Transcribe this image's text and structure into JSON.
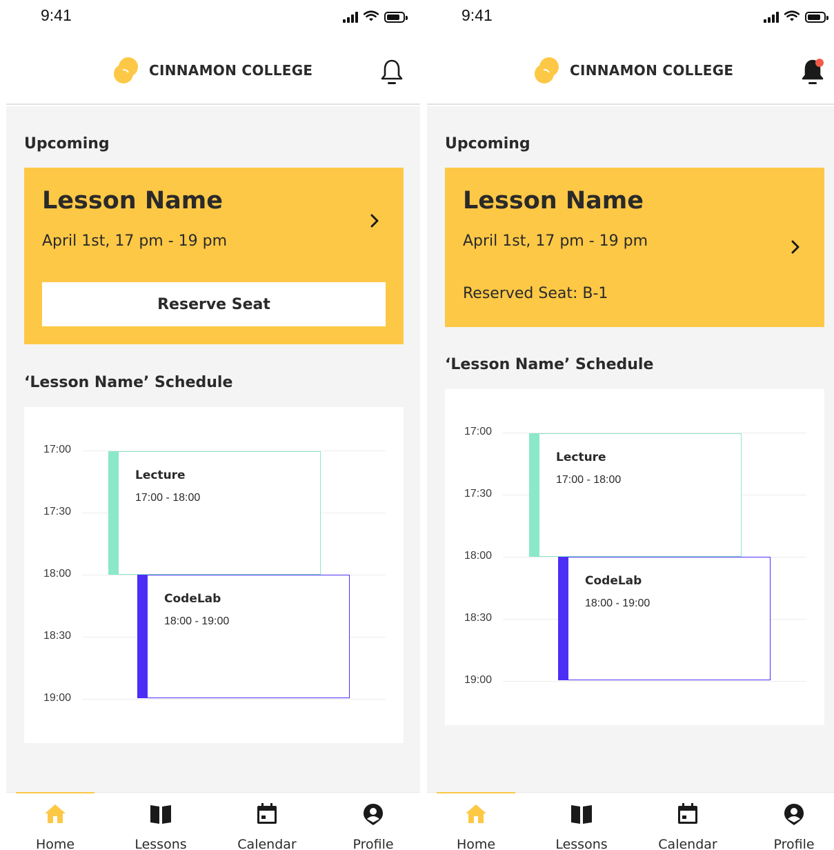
{
  "status": {
    "time": "9:41"
  },
  "header": {
    "brand": "CINNAMON COLLEGE"
  },
  "colors": {
    "accent": "#fdc845",
    "lecture": "#8be8c9",
    "codelab": "#4b2ff7",
    "notification_dot": "#f25b4a"
  },
  "screens": [
    {
      "upcoming_title": "Upcoming",
      "card": {
        "lesson_name": "Lesson Name",
        "date": "April 1st, 17 pm - 19 pm",
        "button_label": "Reserve Seat"
      },
      "schedule_title": "‘Lesson Name’ Schedule",
      "notification_active": false
    },
    {
      "upcoming_title": "Upcoming",
      "card": {
        "lesson_name": "Lesson Name",
        "date": "April 1st, 17 pm - 19 pm",
        "reserved_text": "Reserved Seat: B-1"
      },
      "schedule_title": "‘Lesson Name’ Schedule",
      "notification_active": true
    }
  ],
  "schedule": {
    "times": [
      "17:00",
      "17:30",
      "18:00",
      "18:30",
      "19:00"
    ],
    "events": [
      {
        "title": "Lecture",
        "time": "17:00 - 18:00"
      },
      {
        "title": "CodeLab",
        "time": "18:00 - 19:00"
      }
    ]
  },
  "tabs": [
    {
      "label": "Home",
      "icon": "home-icon",
      "active": true
    },
    {
      "label": "Lessons",
      "icon": "book-icon",
      "active": false
    },
    {
      "label": "Calendar",
      "icon": "calendar-icon",
      "active": false
    },
    {
      "label": "Profile",
      "icon": "profile-icon",
      "active": false
    }
  ]
}
